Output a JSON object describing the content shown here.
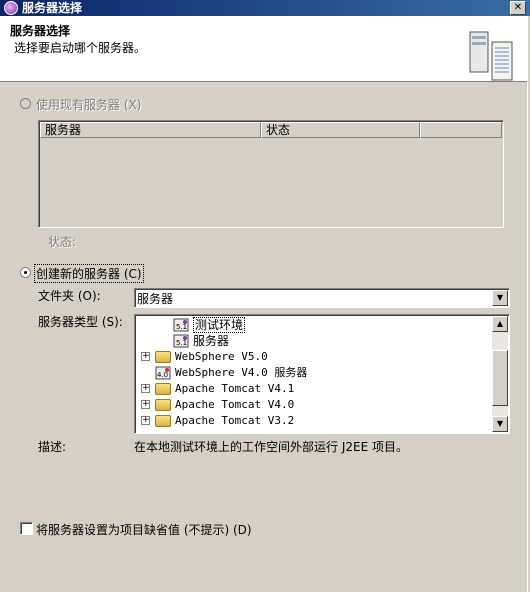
{
  "window": {
    "title": "服务器选择",
    "close_glyph": "✕"
  },
  "header": {
    "title": "服务器选择",
    "description": "选择要启动哪个服务器。",
    "icon": "server-tower-icon"
  },
  "existing": {
    "radio_label": "使用现有服务器 (X)",
    "columns": [
      "服务器",
      "状态",
      ""
    ],
    "status_label": "状态:"
  },
  "create_new": {
    "radio_label": "创建新的服务器 (C)",
    "folder_label": "文件夹 (O):",
    "folder_value": "服务器",
    "server_type_label": "服务器类型 (S):",
    "tree_items": [
      {
        "label": "测试环境",
        "level": 2,
        "icon": "server-5.1-icon",
        "selected": true
      },
      {
        "label": "服务器",
        "level": 2,
        "icon": "server-5.1-icon"
      },
      {
        "label": "WebSphere V5.0",
        "level": 0,
        "icon": "folder-icon",
        "expander": "+"
      },
      {
        "label": "WebSphere V4.0 服务器",
        "level": 0,
        "icon": "server-4.0-icon"
      },
      {
        "label": "Apache Tomcat V4.1",
        "level": 0,
        "icon": "folder-icon",
        "expander": "+"
      },
      {
        "label": "Apache Tomcat V4.0",
        "level": 0,
        "icon": "folder-icon",
        "expander": "+"
      },
      {
        "label": "Apache Tomcat V3.2",
        "level": 0,
        "icon": "folder-icon",
        "expander": "+"
      }
    ],
    "description_label": "描述:",
    "description_value": "在本地测试环境上的工作空间外部运行 J2EE 项目。"
  },
  "footer": {
    "default_checkbox_label": "将服务器设置为项目缺省值 (不提示) (D)"
  }
}
